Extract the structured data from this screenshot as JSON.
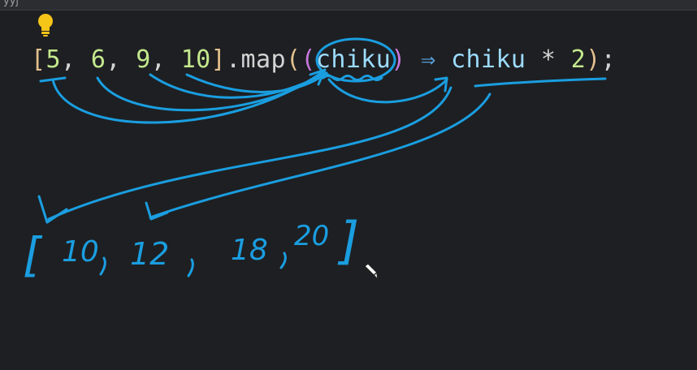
{
  "window": {
    "tab_title_fragment": "yyj  "
  },
  "code": {
    "open_bracket": "[",
    "n1": "5",
    "c1": ", ",
    "n2": "6",
    "c2": ", ",
    "n3": "9",
    "c3": ", ",
    "n4": "10",
    "close_bracket": "]",
    "dot_map": ".map",
    "paren_open_outer": "(",
    "paren_open_inner": "(",
    "param": "chiku",
    "paren_close_inner": ")",
    "arrow": " ⇒ ",
    "body_ident": "chiku",
    "multiply": " * ",
    "factor": "2",
    "paren_close_outer": ")",
    "semicolon": ";"
  },
  "handwritten_result": {
    "open_bracket": "[",
    "v1": "10",
    "v2": "12",
    "v3": "18",
    "v4": "20",
    "close_bracket": "]"
  },
  "colors": {
    "background": "#1e1f22",
    "ink": "#1a9ee0",
    "bulb": "#f5c518"
  },
  "icons": {
    "lightbulb": "lightbulb-icon",
    "pencil": "pencil-cursor-icon"
  }
}
